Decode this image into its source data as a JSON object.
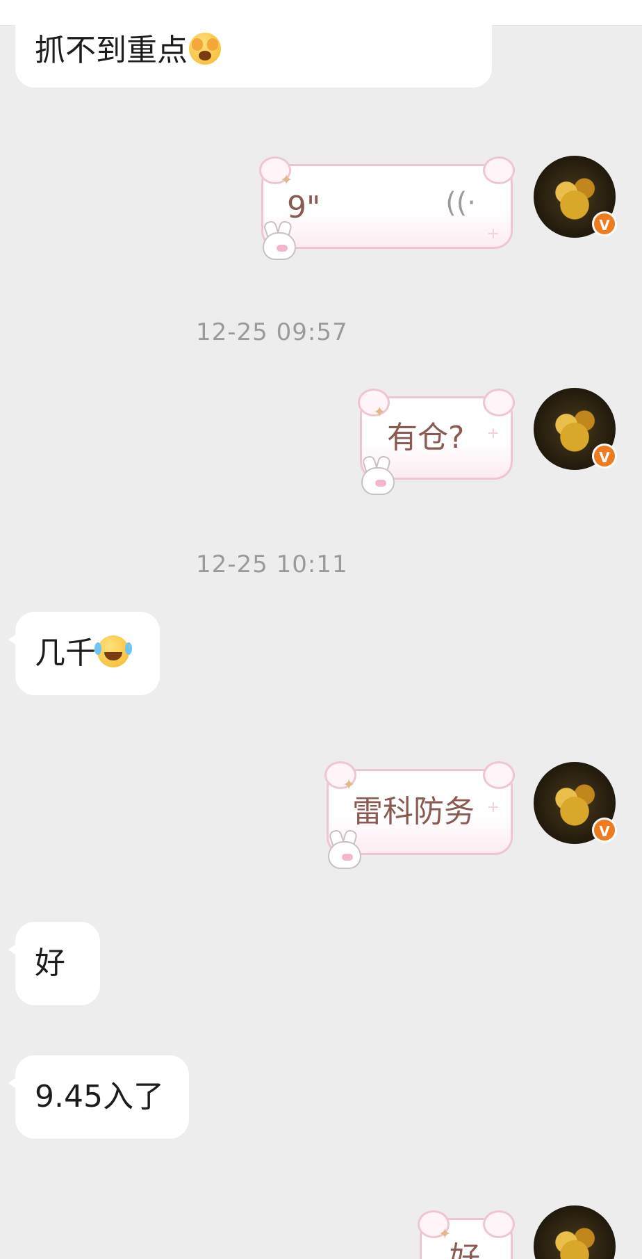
{
  "messages": [
    {
      "side": "in",
      "text": "抓不到重点",
      "emoji": "face-with-hands-over-eyes-emoji"
    },
    {
      "side": "out",
      "type": "voice",
      "duration": "9\"",
      "icon": "voice-wave-icon"
    },
    {
      "timestamp": "12-25 09:57"
    },
    {
      "side": "out",
      "text": "有仓?"
    },
    {
      "timestamp": "12-25 10:11"
    },
    {
      "side": "in",
      "text": "几千",
      "emoji": "rolling-laughing-emoji"
    },
    {
      "side": "out",
      "text": "雷科防务"
    },
    {
      "side": "in",
      "text": "好"
    },
    {
      "side": "in",
      "text": "9.45入了"
    },
    {
      "side": "out",
      "text": "好"
    }
  ],
  "avatar": {
    "badge": "V",
    "badge_color": "#f07a1e"
  },
  "theme": {
    "page_bg": "#ededed",
    "incoming_bubble_bg": "#ffffff",
    "outgoing_border": "#efc5d2",
    "outgoing_text": "#8a5a52",
    "timestamp_color": "#9a9a9a"
  }
}
